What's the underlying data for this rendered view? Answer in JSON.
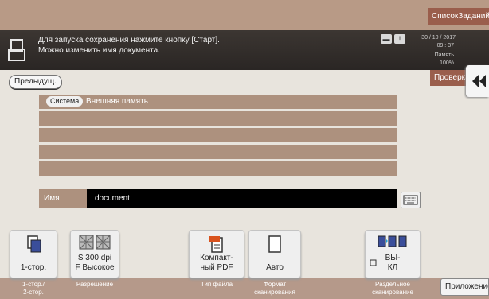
{
  "header": {
    "job_list_label": "СписокЗаданий"
  },
  "message": {
    "line1": "Для запуска сохранения нажмите кнопку [Старт].",
    "line2": "Можно изменить имя документа."
  },
  "status": {
    "date": "30 / 10 / 2017",
    "time": "09 : 37",
    "memory_label": "Память",
    "memory_value": "100%"
  },
  "nav": {
    "previous_label": "Предыдущ.",
    "check_label": "Проверка"
  },
  "location": {
    "chip_label": "Система",
    "path_label": "Внешняя память"
  },
  "document_name": {
    "label": "Имя",
    "value": "document"
  },
  "settings": [
    {
      "value": "1-стор.",
      "caption": "1-стор./\n2-стор."
    },
    {
      "value": "S 300 dpi\nF Высокое",
      "caption": "Разрешение"
    },
    {
      "value": "Компакт-\nный PDF",
      "caption": "Тип файла"
    },
    {
      "value": "Авто",
      "caption": "Формат\nсканирования"
    },
    {
      "value": "ВЫ-\nКЛ",
      "caption": "Раздельное\nсканирование"
    }
  ],
  "footer": {
    "app_label": "Приложение"
  },
  "icons": {
    "doc": "document-icon",
    "collapse": "double-chevron-left-icon",
    "keyboard": "keyboard-icon"
  },
  "colors": {
    "accent": "#9a5e4c",
    "panel_row": "#ad917e",
    "message_bar": "#2f2a27"
  }
}
